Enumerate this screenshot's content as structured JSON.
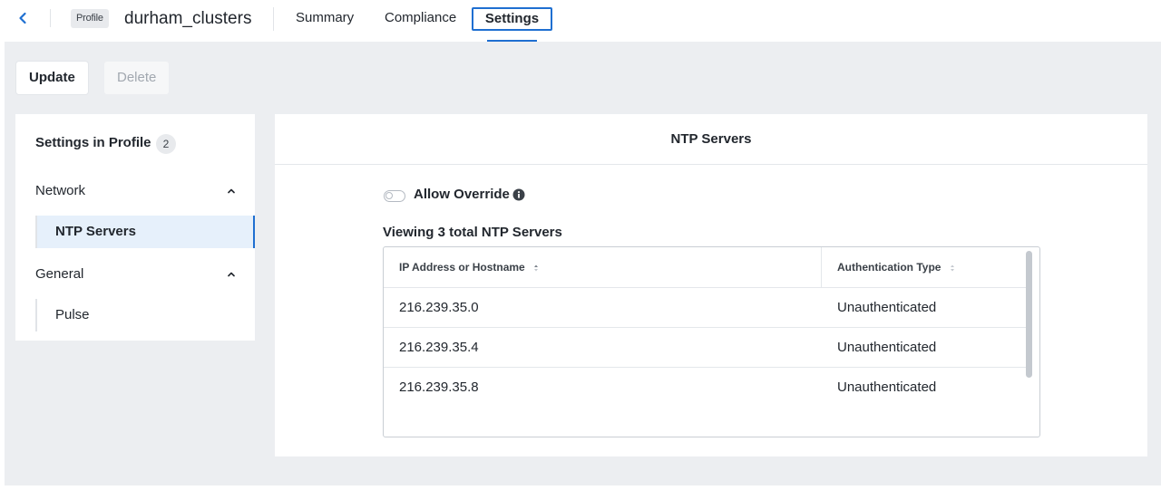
{
  "header": {
    "profile_chip": "Profile",
    "profile_name": "durham_clusters",
    "tabs": [
      {
        "label": "Summary"
      },
      {
        "label": "Compliance"
      },
      {
        "label": "Settings"
      }
    ]
  },
  "actions": {
    "update_label": "Update",
    "delete_label": "Delete"
  },
  "left_panel": {
    "title": "Settings in Profile",
    "count": "2",
    "groups": [
      {
        "label": "Network",
        "items": [
          {
            "label": "NTP Servers",
            "active": true
          }
        ]
      },
      {
        "label": "General",
        "items": [
          {
            "label": "Pulse",
            "active": false
          }
        ]
      }
    ]
  },
  "right_panel": {
    "title": "NTP Servers",
    "allow_override_label": "Allow Override",
    "viewing_text": "Viewing 3 total NTP Servers",
    "table": {
      "columns": [
        "IP Address or Hostname",
        "Authentication Type"
      ],
      "rows": [
        {
          "ip": "216.239.35.0",
          "auth": "Unauthenticated"
        },
        {
          "ip": "216.239.35.4",
          "auth": "Unauthenticated"
        },
        {
          "ip": "216.239.35.8",
          "auth": "Unauthenticated"
        }
      ]
    }
  },
  "colors": {
    "accent": "#1f6fd1",
    "background": "#eceef1",
    "active_item_bg": "#e6f0fb"
  },
  "icons": {
    "back": "chevron-left-icon",
    "group_toggle": "chevron-up-icon",
    "info": "info-icon",
    "sort": "sort-icon"
  }
}
